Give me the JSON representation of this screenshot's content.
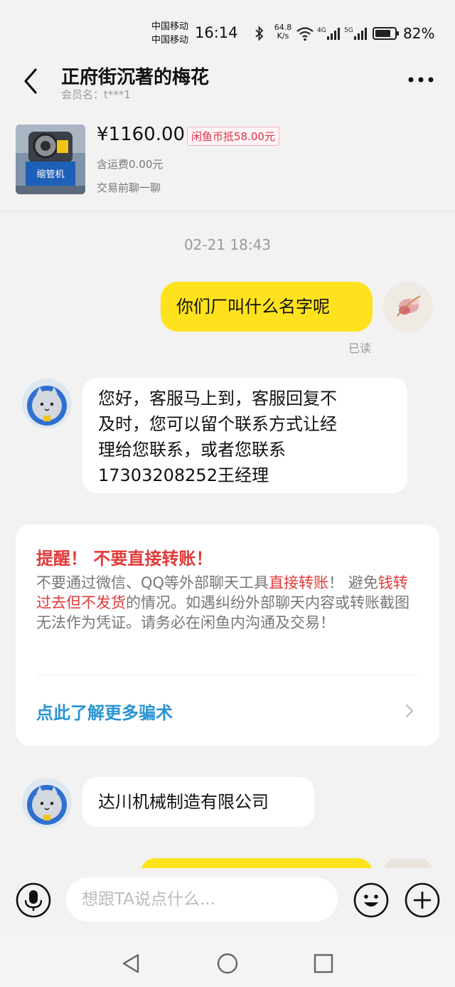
{
  "status_bar": {
    "carrier_1": "中国移动",
    "carrier_2": "中国移动",
    "time": "16:14",
    "net_speed_value": "64.8",
    "net_speed_unit": "K/s",
    "battery_percent": "82%",
    "icons": [
      "bluetooth-icon",
      "wifi-icon",
      "signal-4g-icon",
      "signal-5g-icon",
      "battery-icon"
    ]
  },
  "header": {
    "title": "正府街沉著的梅花",
    "member_label": "会员名：t***1"
  },
  "product": {
    "price": "¥1160.00",
    "coin_badge": "闲鱼币抵58.00元",
    "shipping": "含运费0.00元",
    "prechat": "交易前聊一聊",
    "image_caption": "缩管机"
  },
  "chat": {
    "timestamp": "02-21 18:43",
    "messages": [
      {
        "from": "me",
        "text": "你们厂叫什么名字呢",
        "status": "已读"
      },
      {
        "from": "other",
        "lines": [
          "您好，客服马上到，客服回复不",
          "及时，您可以留个联系方式让经",
          "理给您联系，或者您联系",
          "17303208252王经理"
        ]
      },
      {
        "from": "other",
        "text": "达川机械制造有限公司"
      }
    ]
  },
  "warning": {
    "title": "提醒！ 不要直接转账！",
    "body_1": "不要通过微信、QQ等外部聊天工具",
    "body_red_1": "直接转账",
    "body_2": "！ 避免",
    "body_red_2": "钱转过去但不发货",
    "body_3": "的情况。如遇纠纷外部聊天内容或转账截图无法作为凭证。请务必在闲鱼内沟通及交易！",
    "link": "点此了解更多骗术"
  },
  "input": {
    "placeholder": "想跟TA说点什么..."
  },
  "colors": {
    "my_bubble": "#ffe21e",
    "warning_red": "#e23a3a",
    "link_blue": "#2a93d5",
    "background": "#f2f2f2"
  }
}
